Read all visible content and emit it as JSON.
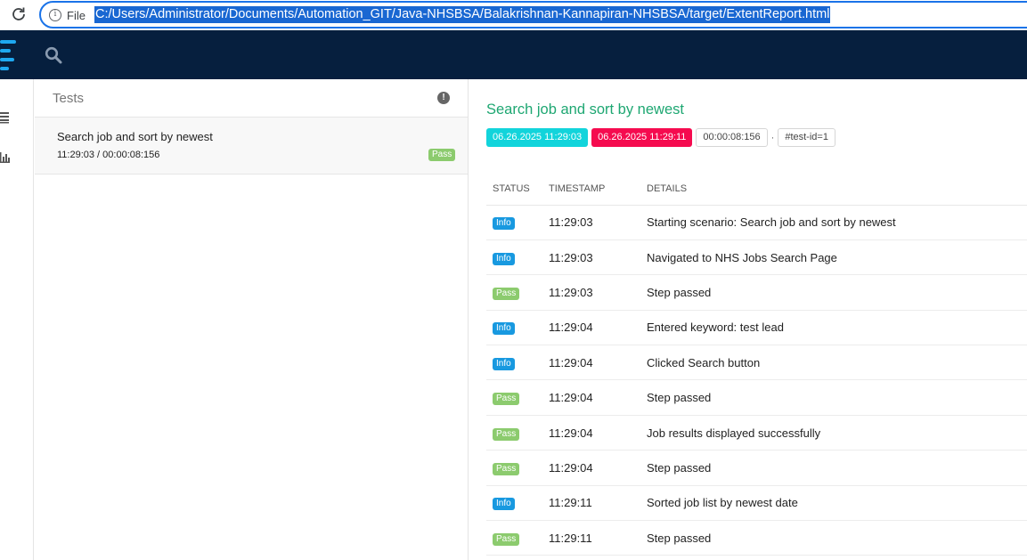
{
  "browser": {
    "scheme_label": "File",
    "url": "C:/Users/Administrator/Documents/Automation_GIT/Java-NHSBSA/Balakrishnan-Kannapiran-NHSBSA/target/ExtentReport.html"
  },
  "navbar": {
    "logo_color": "#1ea8f0",
    "background": "#061f3e",
    "search_icon": "search-icon"
  },
  "sidebar": {
    "items": [
      {
        "icon": "list-icon"
      },
      {
        "icon": "bar-chart-icon"
      }
    ]
  },
  "test_list": {
    "header": "Tests",
    "alert_glyph": "!",
    "items": [
      {
        "name": "Search job and sort by newest",
        "meta": "11:29:03 / 00:00:08:156",
        "status": "Pass"
      }
    ]
  },
  "detail": {
    "title": "Search job and sort by newest",
    "start_time": "06.26.2025 11:29:03",
    "end_time": "06.26.2025 11:29:11",
    "duration": "00:00:08:156",
    "separator": "·",
    "test_id": "#test-id=1",
    "colors": {
      "title": "#1ea772",
      "start": "#12d4db",
      "end": "#f50b4f",
      "pass": "#8ccb6e",
      "info": "#1899e0"
    },
    "columns": {
      "status": "STATUS",
      "timestamp": "TIMESTAMP",
      "details": "DETAILS"
    },
    "logs": [
      {
        "status": "Info",
        "time": "11:29:03",
        "details": "Starting scenario: Search job and sort by newest"
      },
      {
        "status": "Info",
        "time": "11:29:03",
        "details": "Navigated to NHS Jobs Search Page"
      },
      {
        "status": "Pass",
        "time": "11:29:03",
        "details": "Step passed"
      },
      {
        "status": "Info",
        "time": "11:29:04",
        "details": "Entered keyword: test lead"
      },
      {
        "status": "Info",
        "time": "11:29:04",
        "details": "Clicked Search button"
      },
      {
        "status": "Pass",
        "time": "11:29:04",
        "details": "Step passed"
      },
      {
        "status": "Pass",
        "time": "11:29:04",
        "details": "Job results displayed successfully"
      },
      {
        "status": "Pass",
        "time": "11:29:04",
        "details": "Step passed"
      },
      {
        "status": "Info",
        "time": "11:29:11",
        "details": "Sorted job list by newest date"
      },
      {
        "status": "Pass",
        "time": "11:29:11",
        "details": "Step passed"
      }
    ]
  }
}
